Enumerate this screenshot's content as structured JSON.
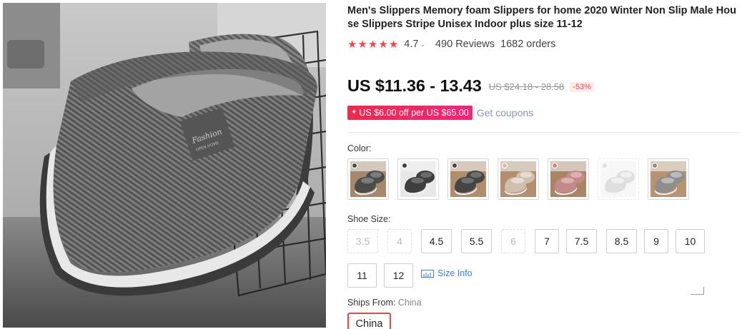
{
  "product": {
    "title": "Men's Slippers Memory foam Slippers for home 2020 Winter Non Slip Male House Slippers Stripe Unisex Indoor plus size 11-12",
    "image_alt": "grey-knit-slippers-photo",
    "rating": "4.7",
    "reviews": "490 Reviews",
    "orders": "1682 orders",
    "price": "US $11.36 - 13.43",
    "old_price": "US $24.18 - 28.58",
    "discount": "-53%",
    "coupon_text": "US $6.00 off per US $65.00",
    "get_coupons": "Get coupons"
  },
  "color": {
    "label": "Color:",
    "swatches": [
      {
        "name": "dark-grey",
        "main": "#4c4c4c",
        "lining": "#7c7c7c",
        "bg": "#a5896d"
      },
      {
        "name": "black",
        "main": "#3e3e3e",
        "lining": "#6a6a6a",
        "bg": "#e8e8e8"
      },
      {
        "name": "charcoal",
        "main": "#454545",
        "lining": "#6e6e6e",
        "bg": "#b08e6c"
      },
      {
        "name": "beige",
        "main": "#cfc0ad",
        "lining": "#e6dccf",
        "bg": "#b38f70"
      },
      {
        "name": "pink",
        "main": "#c48a8a",
        "lining": "#dcb0ae",
        "bg": "#a98466"
      },
      {
        "name": "light-grey",
        "main": "#c4c4c4",
        "lining": "#e4e4e4",
        "bg": "#f2f2f2"
      },
      {
        "name": "grey",
        "main": "#8e8e8e",
        "lining": "#bbbbbb",
        "bg": "#b89372"
      }
    ]
  },
  "shoe_size": {
    "label": "Shoe Size:",
    "sizes": [
      {
        "label": "3.5",
        "disabled": true
      },
      {
        "label": "4",
        "disabled": true
      },
      {
        "label": "4.5",
        "disabled": false
      },
      {
        "label": "5.5",
        "disabled": false
      },
      {
        "label": "6",
        "disabled": true
      },
      {
        "label": "7",
        "disabled": false
      },
      {
        "label": "7.5",
        "disabled": false
      },
      {
        "label": "8.5",
        "disabled": false
      },
      {
        "label": "9",
        "disabled": false
      },
      {
        "label": "10",
        "disabled": false
      },
      {
        "label": "11",
        "disabled": false
      },
      {
        "label": "12",
        "disabled": false
      }
    ],
    "size_info": "Size Info"
  },
  "ships_from": {
    "label": "Ships From:",
    "value": "China",
    "selected": "China"
  },
  "colors": {
    "accent": "#f5464a",
    "price": "#111111",
    "link": "#3b7ed9"
  }
}
